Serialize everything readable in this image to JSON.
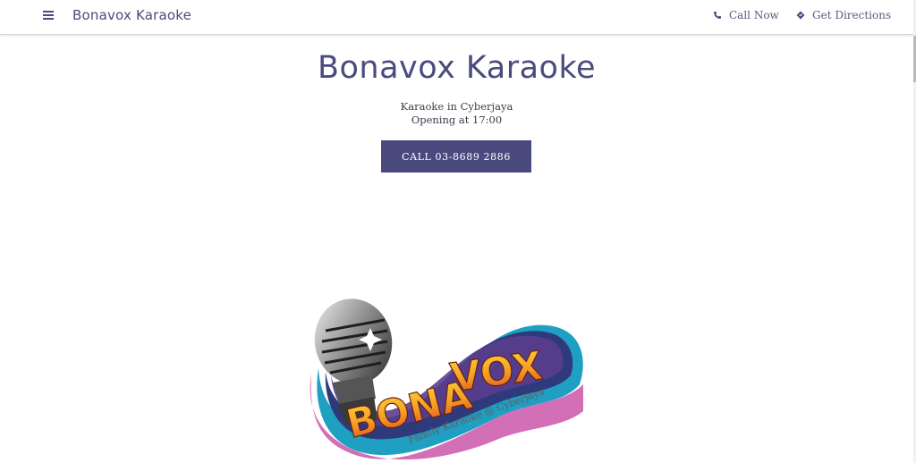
{
  "header": {
    "brand": "Bonavox Karaoke",
    "menu_icon": "menu-icon",
    "links": [
      {
        "label": "Call Now",
        "icon": "phone-icon"
      },
      {
        "label": "Get Directions",
        "icon": "directions-icon"
      }
    ]
  },
  "hero": {
    "title": "Bonavox Karaoke",
    "category": "Karaoke in Cyberjaya",
    "hours": "Opening at 17:00",
    "cta_label": "CALL 03-8689 2886"
  },
  "logo": {
    "wordmark": "BONA VOX",
    "tagline": "Family Karaoke @ Cyberjaya"
  },
  "colors": {
    "accent": "#4b4a7e",
    "background": "#ffffff"
  }
}
